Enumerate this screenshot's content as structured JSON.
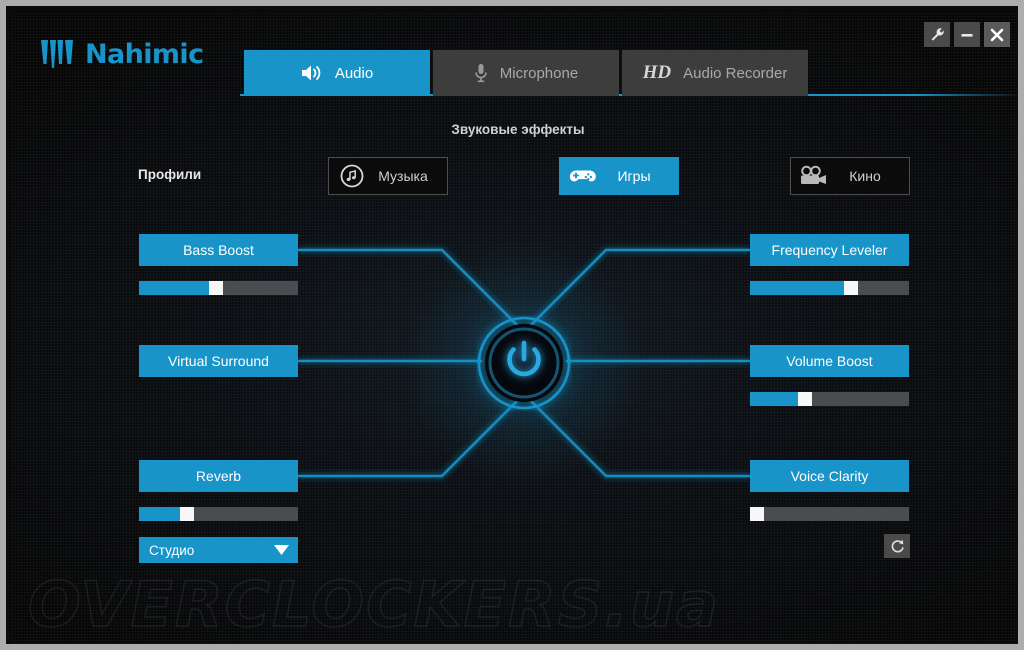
{
  "app": {
    "name": "Nahimic",
    "accent_color": "#1894c9",
    "background_color": "#0a0d11"
  },
  "titlebar": {
    "buttons": [
      {
        "name": "settings",
        "icon": "wrench-icon"
      },
      {
        "name": "minimize",
        "icon": "minimize-icon"
      },
      {
        "name": "close",
        "icon": "close-icon"
      }
    ]
  },
  "tabs": [
    {
      "label": "Audio",
      "icon": "speaker-icon",
      "active": true
    },
    {
      "label": "Microphone",
      "icon": "microphone-icon",
      "active": false
    },
    {
      "label": "Audio Recorder",
      "badge": "HD",
      "icon": "hd-icon",
      "active": false
    }
  ],
  "section": {
    "title": "Звуковые эффекты"
  },
  "profiles": {
    "label": "Профили",
    "items": [
      {
        "label": "Музыка",
        "icon": "music-note-icon",
        "active": false
      },
      {
        "label": "Игры",
        "icon": "gamepad-icon",
        "active": true
      },
      {
        "label": "Кино",
        "icon": "movie-camera-icon",
        "active": false
      }
    ]
  },
  "power": {
    "label": "power-button",
    "state": "on"
  },
  "effects": {
    "left": [
      {
        "label": "Bass Boost",
        "has_slider": true,
        "value": 48
      },
      {
        "label": "Virtual Surround",
        "has_slider": false,
        "value": null
      },
      {
        "label": "Reverb",
        "has_slider": true,
        "value": 28
      }
    ],
    "right": [
      {
        "label": "Frequency Leveler",
        "has_slider": true,
        "value": 65
      },
      {
        "label": "Volume Boost",
        "has_slider": true,
        "value": 33
      },
      {
        "label": "Voice Clarity",
        "has_slider": true,
        "value": 0
      }
    ]
  },
  "reverb_preset": {
    "value": "Студио",
    "arrow": "chevron-down-icon"
  },
  "reset": {
    "icon": "refresh-icon",
    "tooltip": "Reset"
  },
  "watermark": {
    "text": "OVERCLOCKERS.ua"
  }
}
